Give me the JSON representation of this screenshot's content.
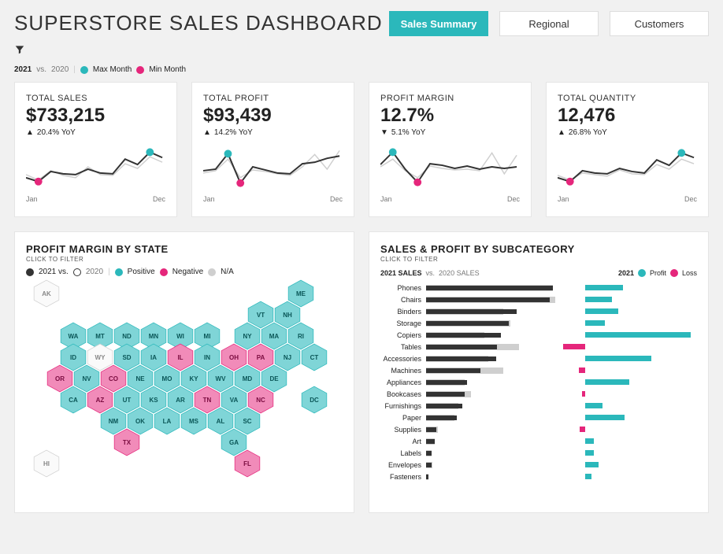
{
  "title": "SUPERSTORE SALES DASHBOARD",
  "tabs": {
    "t0": "Sales Summary",
    "t1": "Regional",
    "t2": "Customers"
  },
  "header_legend": {
    "year_cur": "2021",
    "vs": " vs. ",
    "year_prev": "2020",
    "max": "Max Month",
    "min": "Min Month"
  },
  "kpi_axis": {
    "start": "Jan",
    "end": "Dec"
  },
  "kpis": {
    "k0": {
      "label": "TOTAL SALES",
      "value": "$733,215",
      "delta_dir": "▲",
      "delta": "20.4% YoY"
    },
    "k1": {
      "label": "TOTAL PROFIT",
      "value": "$93,439",
      "delta_dir": "▲",
      "delta": "14.2% YoY"
    },
    "k2": {
      "label": "PROFIT MARGIN",
      "value": "12.7%",
      "delta_dir": "▼",
      "delta": "5.1% YoY"
    },
    "k3": {
      "label": "TOTAL QUANTITY",
      "value": "12,476",
      "delta_dir": "▲",
      "delta": "26.8% YoY"
    }
  },
  "map_panel": {
    "title": "PROFIT MARGIN BY STATE",
    "sub": "CLICK TO FILTER",
    "legend": {
      "cur": "2021 vs.",
      "prev": "2020",
      "pos": "Positive",
      "neg": "Negative",
      "na": "N/A"
    }
  },
  "subcat_panel": {
    "title": "SALES & PROFIT BY SUBCATEGORY",
    "sub": "CLICK TO FILTER",
    "legend_left_a": "2021 SALES",
    "legend_left_b": " vs. ",
    "legend_left_c": "2020 SALES",
    "legend_right_year": "2021",
    "legend_right_profit": "Profit",
    "legend_right_loss": "Loss"
  },
  "subcats": {
    "r0": {
      "label": "Phones"
    },
    "r1": {
      "label": "Chairs"
    },
    "r2": {
      "label": "Binders"
    },
    "r3": {
      "label": "Storage"
    },
    "r4": {
      "label": "Copiers"
    },
    "r5": {
      "label": "Tables"
    },
    "r6": {
      "label": "Accessories"
    },
    "r7": {
      "label": "Machines"
    },
    "r8": {
      "label": "Appliances"
    },
    "r9": {
      "label": "Bookcases"
    },
    "r10": {
      "label": "Furnishings"
    },
    "r11": {
      "label": "Paper"
    },
    "r12": {
      "label": "Supplies"
    },
    "r13": {
      "label": "Art"
    },
    "r14": {
      "label": "Labels"
    },
    "r15": {
      "label": "Envelopes"
    },
    "r16": {
      "label": "Fasteners"
    }
  },
  "states": {
    "AK": "AK",
    "HI": "HI",
    "ME": "ME",
    "VT": "VT",
    "NH": "NH",
    "WA": "WA",
    "MT": "MT",
    "ND": "ND",
    "MN": "MN",
    "WI": "WI",
    "MI": "MI",
    "NY": "NY",
    "MA": "MA",
    "RI": "RI",
    "ID": "ID",
    "WY": "WY",
    "SD": "SD",
    "IA": "IA",
    "IL": "IL",
    "IN": "IN",
    "OH": "OH",
    "PA": "PA",
    "NJ": "NJ",
    "CT": "CT",
    "OR": "OR",
    "NV": "NV",
    "CO": "CO",
    "NE": "NE",
    "MO": "MO",
    "KY": "KY",
    "WV": "WV",
    "MD": "MD",
    "DE": "DE",
    "CA": "CA",
    "AZ": "AZ",
    "UT": "UT",
    "KS": "KS",
    "AR": "AR",
    "TN": "TN",
    "VA": "VA",
    "NC": "NC",
    "DC": "DC",
    "NM": "NM",
    "OK": "OK",
    "LA": "LA",
    "MS": "MS",
    "AL": "AL",
    "SC": "SC",
    "TX": "TX",
    "GA": "GA",
    "FL": "FL"
  },
  "chart_data": {
    "kpi_sparklines": {
      "type": "line",
      "x": [
        "Jan",
        "Feb",
        "Mar",
        "Apr",
        "May",
        "Jun",
        "Jul",
        "Aug",
        "Sep",
        "Oct",
        "Nov",
        "Dec"
      ],
      "series_note": "Index 0..100 relative to each KPI's own range; read from sparkline shapes",
      "total_sales": {
        "2021": [
          30,
          22,
          42,
          38,
          36,
          48,
          40,
          38,
          70,
          58,
          85,
          72
        ],
        "2020": [
          36,
          26,
          44,
          34,
          30,
          52,
          36,
          34,
          60,
          50,
          74,
          62
        ],
        "max_idx": 10,
        "min_idx": 1
      },
      "total_profit": {
        "2021": [
          44,
          48,
          82,
          18,
          52,
          46,
          40,
          38,
          60,
          62,
          72,
          76
        ],
        "2020": [
          40,
          44,
          70,
          30,
          46,
          42,
          38,
          34,
          52,
          80,
          48,
          88
        ],
        "max_idx": 2,
        "min_idx": 3
      },
      "profit_margin": {
        "2021": [
          58,
          85,
          48,
          20,
          60,
          56,
          50,
          54,
          48,
          52,
          50,
          52
        ],
        "2020": [
          52,
          70,
          44,
          30,
          54,
          50,
          46,
          48,
          44,
          84,
          38,
          78
        ],
        "max_idx": 1,
        "min_idx": 3
      },
      "total_quantity": {
        "2021": [
          30,
          22,
          44,
          40,
          38,
          50,
          42,
          40,
          68,
          56,
          84,
          72
        ],
        "2020": [
          34,
          26,
          40,
          36,
          32,
          46,
          38,
          36,
          58,
          48,
          70,
          60
        ],
        "max_idx": 10,
        "min_idx": 1
      }
    },
    "profit_margin_by_state": {
      "type": "hexmap",
      "categories": [
        "positive",
        "negative",
        "na"
      ],
      "states": {
        "AK": "na",
        "HI": "na",
        "ME": "positive",
        "VT": "positive",
        "NH": "positive",
        "WA": "positive",
        "MT": "positive",
        "ND": "positive",
        "MN": "positive",
        "WI": "positive",
        "MI": "positive",
        "NY": "positive",
        "MA": "positive",
        "RI": "positive",
        "ID": "positive",
        "WY": "na",
        "SD": "positive",
        "IA": "positive",
        "IL": "negative",
        "IN": "positive",
        "OH": "negative",
        "PA": "negative",
        "NJ": "positive",
        "CT": "positive",
        "OR": "negative",
        "NV": "positive",
        "CO": "negative",
        "NE": "positive",
        "MO": "positive",
        "KY": "positive",
        "WV": "positive",
        "MD": "positive",
        "DE": "positive",
        "CA": "positive",
        "AZ": "negative",
        "UT": "positive",
        "KS": "positive",
        "AR": "positive",
        "TN": "negative",
        "VA": "positive",
        "NC": "negative",
        "DC": "positive",
        "NM": "positive",
        "OK": "positive",
        "LA": "positive",
        "MS": "positive",
        "AL": "positive",
        "SC": "positive",
        "TX": "negative",
        "GA": "positive",
        "FL": "negative"
      }
    },
    "sales_profit_by_subcategory": {
      "type": "bar",
      "unit_note": "Values approximate, read as relative magnitude on 0-100 sales scale; profit on -20..+100",
      "rows": [
        {
          "label": "Phones",
          "sales_2021": 98,
          "sales_2020": 98,
          "profit": 34
        },
        {
          "label": "Chairs",
          "sales_2021": 96,
          "sales_2020": 100,
          "profit": 24
        },
        {
          "label": "Binders",
          "sales_2021": 70,
          "sales_2020": 60,
          "profit": 30
        },
        {
          "label": "Storage",
          "sales_2021": 64,
          "sales_2020": 65,
          "profit": 18
        },
        {
          "label": "Copiers",
          "sales_2021": 58,
          "sales_2020": 45,
          "profit": 96
        },
        {
          "label": "Tables",
          "sales_2021": 55,
          "sales_2020": 72,
          "profit": -20
        },
        {
          "label": "Accessories",
          "sales_2021": 54,
          "sales_2020": 48,
          "profit": 60
        },
        {
          "label": "Machines",
          "sales_2021": 42,
          "sales_2020": 60,
          "profit": -6
        },
        {
          "label": "Appliances",
          "sales_2021": 32,
          "sales_2020": 30,
          "profit": 40
        },
        {
          "label": "Bookcases",
          "sales_2021": 30,
          "sales_2020": 35,
          "profit": -3
        },
        {
          "label": "Furnishings",
          "sales_2021": 28,
          "sales_2020": 25,
          "profit": 16
        },
        {
          "label": "Paper",
          "sales_2021": 24,
          "sales_2020": 22,
          "profit": 36
        },
        {
          "label": "Supplies",
          "sales_2021": 8,
          "sales_2020": 9,
          "profit": -5
        },
        {
          "label": "Art",
          "sales_2021": 7,
          "sales_2020": 7,
          "profit": 8
        },
        {
          "label": "Labels",
          "sales_2021": 4,
          "sales_2020": 4,
          "profit": 8
        },
        {
          "label": "Envelopes",
          "sales_2021": 4,
          "sales_2020": 5,
          "profit": 12
        },
        {
          "label": "Fasteners",
          "sales_2021": 2,
          "sales_2020": 2,
          "profit": 6
        }
      ]
    }
  }
}
